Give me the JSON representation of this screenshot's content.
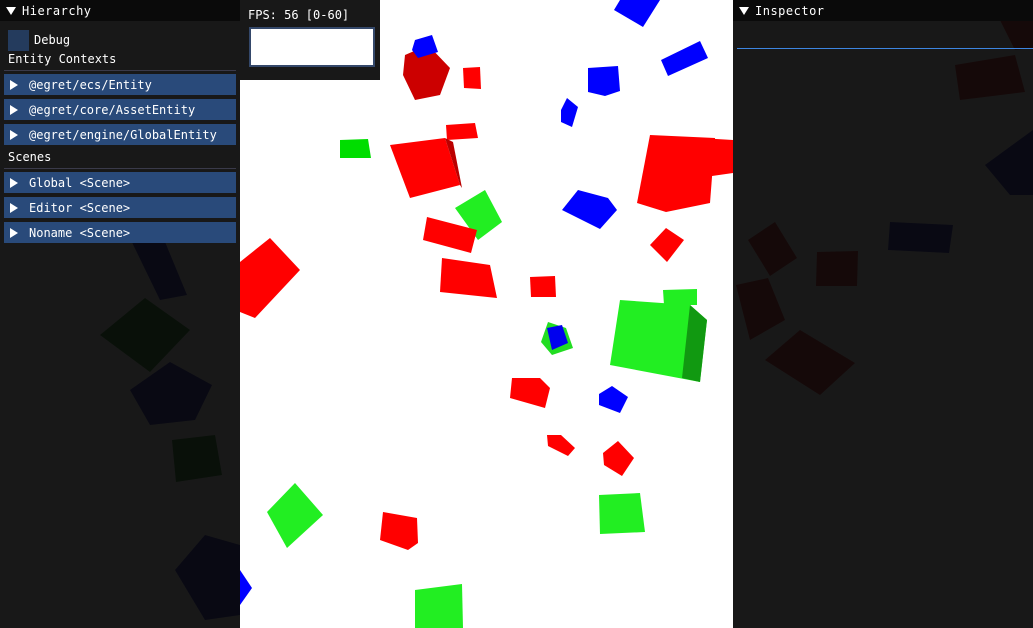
{
  "hierarchy": {
    "title": "Hierarchy",
    "debug_label": "Debug",
    "entity_contexts_label": "Entity Contexts",
    "entity_contexts": [
      {
        "label": "@egret/ecs/Entity"
      },
      {
        "label": "@egret/core/AssetEntity"
      },
      {
        "label": "@egret/engine/GlobalEntity"
      }
    ],
    "scenes_label": "Scenes",
    "scenes": [
      {
        "label": "Global <Scene>"
      },
      {
        "label": "Editor <Scene>"
      },
      {
        "label": "Noname <Scene>"
      }
    ]
  },
  "inspector": {
    "title": "Inspector"
  },
  "fps_overlay": {
    "text": "FPS: 56 [0-60]"
  },
  "colors": {
    "panel_bg": "#0a0a0a",
    "tree_item_bg": "#294a7a",
    "cube_red": "#ff0000",
    "cube_green": "#00ff00",
    "cube_blue": "#0000ff",
    "inspector_line": "#3d85e0"
  }
}
